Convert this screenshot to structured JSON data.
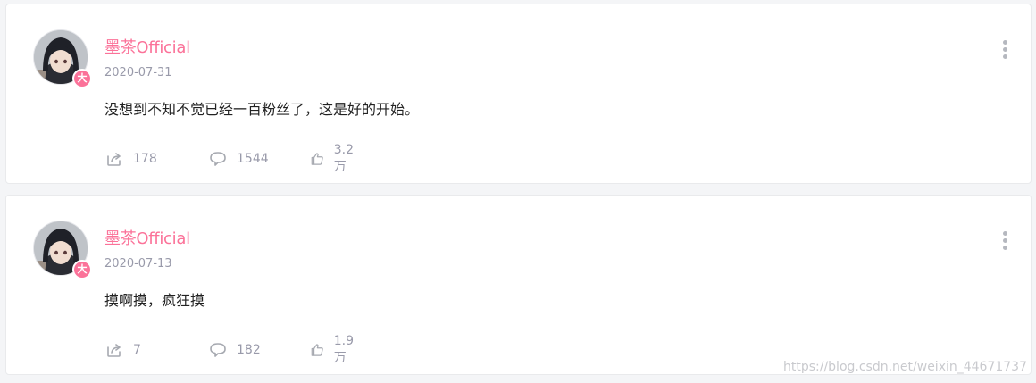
{
  "colors": {
    "accent": "#fb7299",
    "muted": "#999aaa",
    "text": "#222222",
    "background": "#f4f5f7"
  },
  "posts": [
    {
      "author": "墨茶Official",
      "badge": "大",
      "date": "2020-07-31",
      "content": "没想到不知不觉已经一百粉丝了，这是好的开始。",
      "shares": "178",
      "comments": "1544",
      "likes": "3.2万"
    },
    {
      "author": "墨茶Official",
      "badge": "大",
      "date": "2020-07-13",
      "content": "摸啊摸，疯狂摸",
      "shares": "7",
      "comments": "182",
      "likes": "1.9万"
    }
  ],
  "icons": {
    "share": "share-icon",
    "comment": "comment-icon",
    "like": "thumbs-up-icon",
    "more": "more-vertical-icon"
  },
  "watermark": "https://blog.csdn.net/weixin_44671737"
}
